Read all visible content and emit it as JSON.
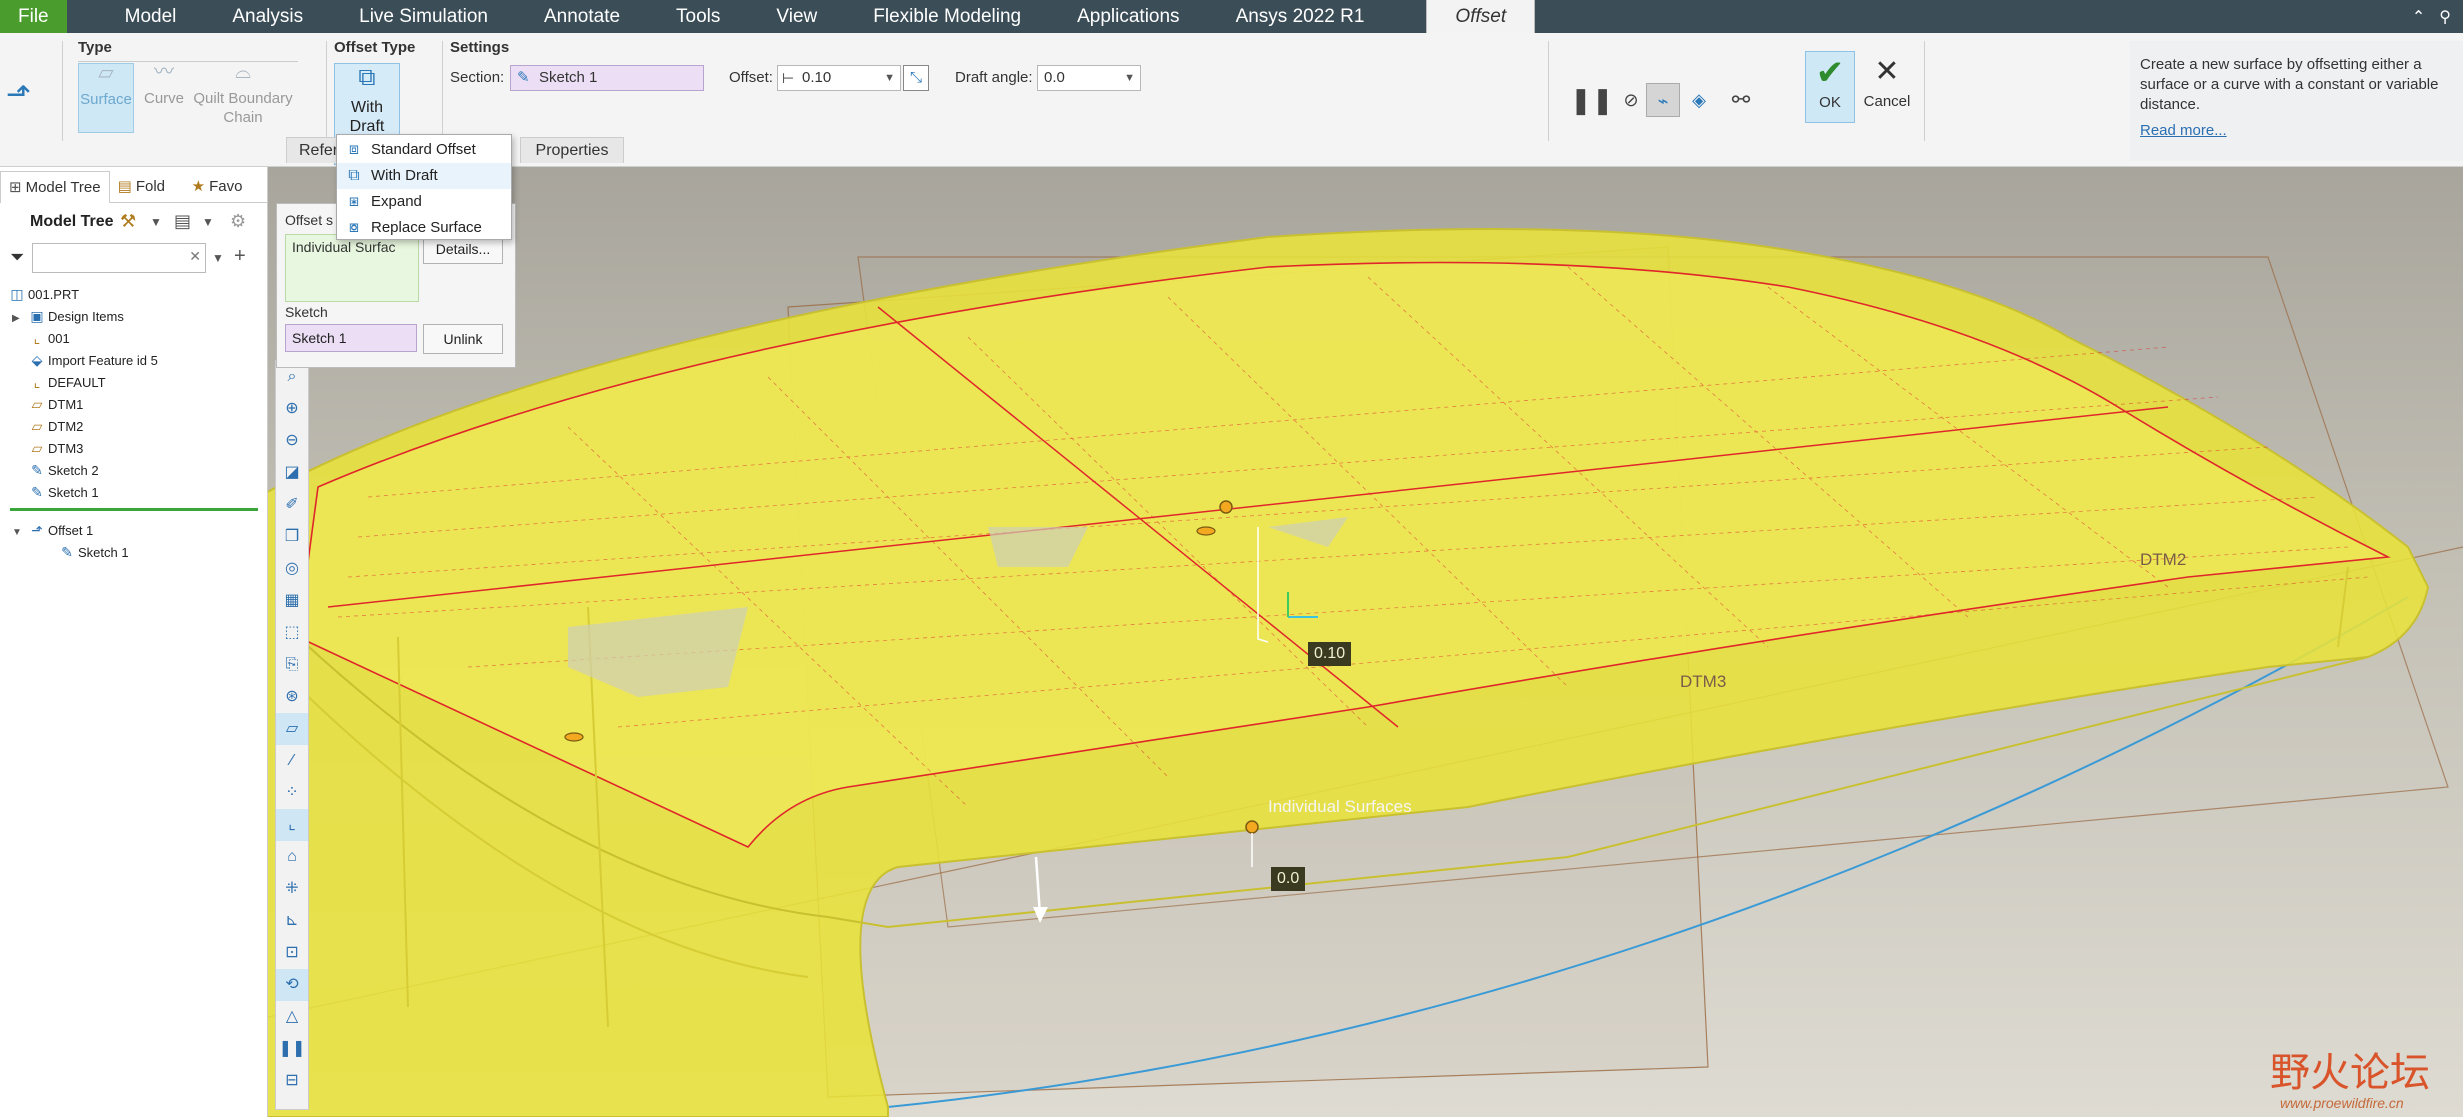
{
  "menubar": {
    "file": "File",
    "items": [
      "Model",
      "Analysis",
      "Live Simulation",
      "Annotate",
      "Tools",
      "View",
      "Flexible Modeling",
      "Applications",
      "Ansys 2022 R1"
    ],
    "active_tab": "Offset"
  },
  "dashboard": {
    "type_title": "Type",
    "type_surface": "Surface",
    "type_curve": "Curve",
    "type_quilt_1": "Quilt Boundary",
    "type_quilt_2": "Chain",
    "offset_type_title": "Offset Type",
    "offset_type_btn_1": "With",
    "offset_type_btn_2": "Draft",
    "settings_title": "Settings",
    "section_label": "Section:",
    "section_value": "Sketch 1",
    "offset_label": "Offset:",
    "offset_value": "0.10",
    "draft_label": "Draft angle:",
    "draft_value": "0.0",
    "ok_label": "OK",
    "cancel_label": "Cancel",
    "help_text": "Create a new surface by offsetting either a surface or a curve with a constant or variable distance.",
    "help_link": "Read more...",
    "tab_references": "Refer",
    "tab_properties": "Properties"
  },
  "offset_menu": {
    "items": [
      "Standard Offset",
      "With Draft",
      "Expand",
      "Replace Surface"
    ]
  },
  "ref_panel": {
    "offset_surface_label": "Offset s",
    "offset_surface_value": "Individual Surfac",
    "details_button": "Details...",
    "sketch_label": "Sketch",
    "sketch_value": "Sketch 1",
    "unlink_button": "Unlink"
  },
  "left_panel": {
    "tabs": [
      "Model Tree",
      "Fold",
      "Favo"
    ],
    "tree_title": "Model Tree",
    "items": [
      {
        "label": "001.PRT",
        "icon": "part-icon"
      },
      {
        "label": "Design Items",
        "icon": "design-items-icon"
      },
      {
        "label": "001",
        "icon": "csys-icon"
      },
      {
        "label": "Import Feature id 5",
        "icon": "import-feature-icon"
      },
      {
        "label": "DEFAULT",
        "icon": "csys-icon"
      },
      {
        "label": "DTM1",
        "icon": "datum-plane-icon"
      },
      {
        "label": "DTM2",
        "icon": "datum-plane-icon"
      },
      {
        "label": "DTM3",
        "icon": "datum-plane-icon"
      },
      {
        "label": "Sketch 2",
        "icon": "sketch-icon"
      },
      {
        "label": "Sketch 1",
        "icon": "sketch-icon"
      },
      {
        "label": "Offset 1",
        "icon": "offset-feature-icon"
      },
      {
        "label": "Sketch 1",
        "icon": "sketch-icon"
      }
    ]
  },
  "viewport": {
    "offset_tag": "0.10",
    "draft_tag": "0.0",
    "surfaces_label": "Individual Surfaces",
    "dtm3_label": "DTM3",
    "dtm2_label": "DTM2"
  },
  "watermark": {
    "cn": "野火论坛",
    "url": "www.proewildfire.cn"
  },
  "colors": {
    "menubar": "#3b4d57",
    "file_tab": "#4a9c2c",
    "model_surface": "#e8e23a",
    "edge": "#e0262a",
    "selection_blue": "#cfe8f6"
  }
}
